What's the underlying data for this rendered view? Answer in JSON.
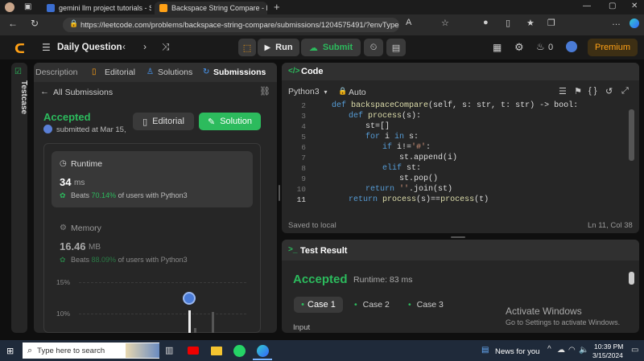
{
  "browser": {
    "tabs": [
      {
        "title": "gemini llm project tutorials - Sea"
      },
      {
        "title": "Backspace String Compare - Leet"
      }
    ],
    "new_tab": "+",
    "url": "https://leetcode.com/problems/backspace-string-compare/submissions/1204575491/?envType=daily-questio..."
  },
  "nav": {
    "title": "Daily Question",
    "run_label": "Run",
    "submit_label": "Submit",
    "fire_count": "0",
    "premium_label": "Premium"
  },
  "side": {
    "testcase_label": "Testcase"
  },
  "left": {
    "tabs": [
      "Description",
      "Editorial",
      "Solutions",
      "Submissions"
    ],
    "back_label": "All Submissions",
    "status": "Accepted",
    "submitted": "submitted at Mar 15,",
    "editorial_btn": "Editorial",
    "solution_btn": "Solution",
    "runtime": {
      "label": "Runtime",
      "value": "34",
      "unit": "ms",
      "beats_prefix": "Beats",
      "beats_pct": "70.14%",
      "beats_suffix": "of users with Python3"
    },
    "memory": {
      "label": "Memory",
      "value": "16.46",
      "unit": "MB",
      "beats_prefix": "Beats",
      "beats_pct": "88.09%",
      "beats_suffix": "of users with Python3"
    },
    "chart_ticks": [
      "15%",
      "10%"
    ]
  },
  "code": {
    "header": "Code",
    "language": "Python3",
    "mode": "Auto",
    "lines": [
      {
        "n": "2",
        "text": "def backspaceCompare(self, s: str, t: str) -> bool:"
      },
      {
        "n": "3",
        "text": "def process(s):"
      },
      {
        "n": "4",
        "text": "st=[]"
      },
      {
        "n": "5",
        "text": "for i in s:"
      },
      {
        "n": "6",
        "text": "if i!='#':"
      },
      {
        "n": "7",
        "text": "st.append(i)"
      },
      {
        "n": "8",
        "text": "elif st:"
      },
      {
        "n": "9",
        "text": "st.pop()"
      },
      {
        "n": "10",
        "text": "return ''.join(st)"
      },
      {
        "n": "11",
        "text": "return process(s)==process(t)"
      }
    ],
    "saved": "Saved to local",
    "cursor": "Ln 11, Col 38"
  },
  "test": {
    "header": "Test Result",
    "status": "Accepted",
    "runtime": "Runtime: 83 ms",
    "cases": [
      "Case 1",
      "Case 2",
      "Case 3"
    ],
    "input_label": "Input"
  },
  "watermark": {
    "title": "Activate Windows",
    "sub": "Go to Settings to activate Windows."
  },
  "taskbar": {
    "search_placeholder": "Type here to search",
    "news": "News for you",
    "time": "10:39 PM",
    "date": "3/15/2024"
  }
}
